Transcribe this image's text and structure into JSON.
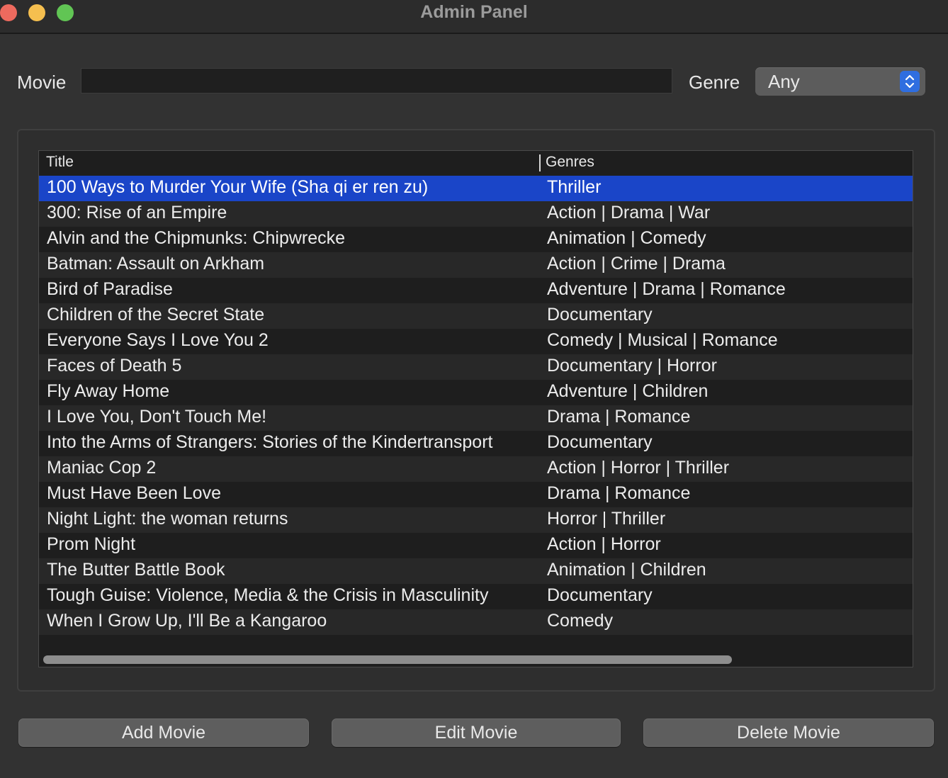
{
  "window": {
    "title": "Admin Panel"
  },
  "search": {
    "movie_label": "Movie",
    "movie_value": "",
    "genre_label": "Genre",
    "genre_value": "Any"
  },
  "table": {
    "columns": [
      "Title",
      "Genres"
    ],
    "selected_index": 0,
    "rows": [
      {
        "title": "100 Ways to Murder Your Wife (Sha qi er ren zu)",
        "genres": "Thriller"
      },
      {
        "title": "300: Rise of an Empire",
        "genres": "Action | Drama | War"
      },
      {
        "title": "Alvin and the Chipmunks: Chipwrecke",
        "genres": "Animation | Comedy"
      },
      {
        "title": "Batman: Assault on Arkham",
        "genres": "Action | Crime | Drama"
      },
      {
        "title": "Bird of Paradise",
        "genres": "Adventure | Drama | Romance"
      },
      {
        "title": "Children of the Secret State",
        "genres": "Documentary"
      },
      {
        "title": "Everyone Says I Love You 2",
        "genres": "Comedy | Musical | Romance"
      },
      {
        "title": "Faces of Death 5",
        "genres": "Documentary | Horror"
      },
      {
        "title": "Fly Away Home",
        "genres": "Adventure | Children"
      },
      {
        "title": "I Love You, Don't Touch Me!",
        "genres": "Drama | Romance"
      },
      {
        "title": "Into the Arms of Strangers: Stories of the Kindertransport",
        "genres": "Documentary"
      },
      {
        "title": "Maniac Cop 2",
        "genres": "Action | Horror | Thriller"
      },
      {
        "title": "Must Have Been Love",
        "genres": "Drama | Romance"
      },
      {
        "title": "Night Light: the woman returns",
        "genres": "Horror | Thriller"
      },
      {
        "title": "Prom Night",
        "genres": "Action | Horror"
      },
      {
        "title": "The Butter Battle Book",
        "genres": "Animation | Children"
      },
      {
        "title": "Tough Guise: Violence, Media & the Crisis in Masculinity",
        "genres": "Documentary"
      },
      {
        "title": "When I Grow Up, I'll Be a Kangaroo",
        "genres": "Comedy"
      },
      {
        "title": "",
        "genres": ""
      }
    ]
  },
  "buttons": {
    "add": "Add Movie",
    "edit": "Edit Movie",
    "delete": "Delete Movie"
  },
  "colors": {
    "selection": "#1a45c8",
    "accent": "#2f6ee0",
    "window_bg": "#323232"
  }
}
